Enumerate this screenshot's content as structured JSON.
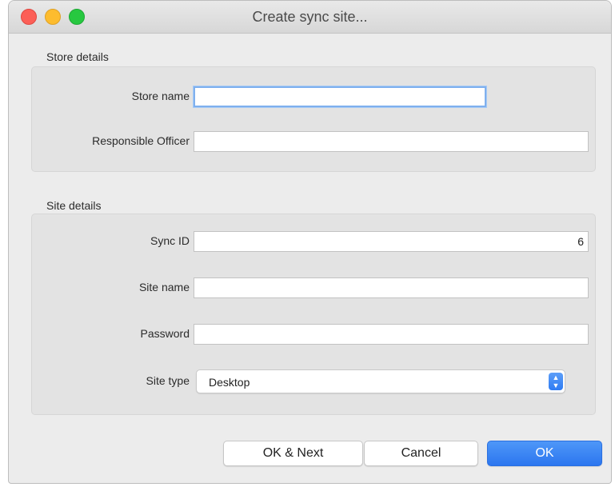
{
  "window": {
    "title": "Create sync site..."
  },
  "store_details": {
    "label": "Store details",
    "store_name": {
      "label": "Store name",
      "value": ""
    },
    "responsible_officer": {
      "label": "Responsible Officer",
      "value": ""
    }
  },
  "site_details": {
    "label": "Site details",
    "sync_id": {
      "label": "Sync ID",
      "value": "6"
    },
    "site_name": {
      "label": "Site name",
      "value": ""
    },
    "password": {
      "label": "Password",
      "value": ""
    },
    "site_type": {
      "label": "Site type",
      "value": "Desktop"
    }
  },
  "buttons": {
    "ok_next": "OK & Next",
    "cancel": "Cancel",
    "ok": "OK"
  },
  "colors": {
    "primary_button": "#2c76ef",
    "focus_ring": "#7fb0ee"
  }
}
